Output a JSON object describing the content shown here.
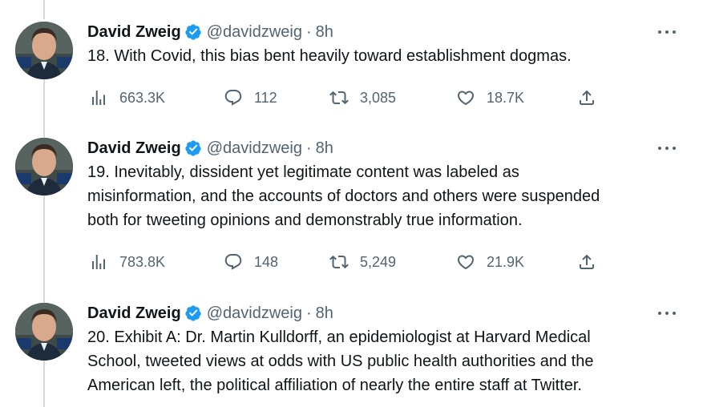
{
  "tweets": [
    {
      "author": "David Zweig",
      "handle": "@davidzweig",
      "separator": "·",
      "time": "8h",
      "text": "18. With Covid, this bias bent heavily toward establishment dogmas.",
      "views": "663.3K",
      "replies": "112",
      "retweets": "3,085",
      "likes": "18.7K"
    },
    {
      "author": "David Zweig",
      "handle": "@davidzweig",
      "separator": "·",
      "time": "8h",
      "text_lines": [
        "19. Inevitably, dissident yet legitimate content was labeled as",
        "misinformation, and the accounts of doctors and others were suspended",
        "both for tweeting opinions and demonstrably true information."
      ],
      "views": "783.8K",
      "replies": "148",
      "retweets": "5,249",
      "likes": "21.9K"
    },
    {
      "author": "David Zweig",
      "handle": "@davidzweig",
      "separator": "·",
      "time": "8h",
      "text_lines": [
        "20. Exhibit A: Dr. Martin Kulldorff, an epidemiologist at Harvard Medical",
        "School, tweeted views at odds with US public health authorities and the",
        "American left, the political affiliation of nearly the entire staff at Twitter."
      ]
    }
  ],
  "icons": {
    "views": "views-icon",
    "reply": "reply-icon",
    "retweet": "retweet-icon",
    "like": "like-icon",
    "share": "share-icon",
    "verified": "verified-badge-icon",
    "more": "more-options-icon"
  },
  "colors": {
    "verified_blue": "#1d9bf0",
    "text": "#0f1419",
    "muted": "#536471",
    "thread_line": "#cfd9de"
  }
}
